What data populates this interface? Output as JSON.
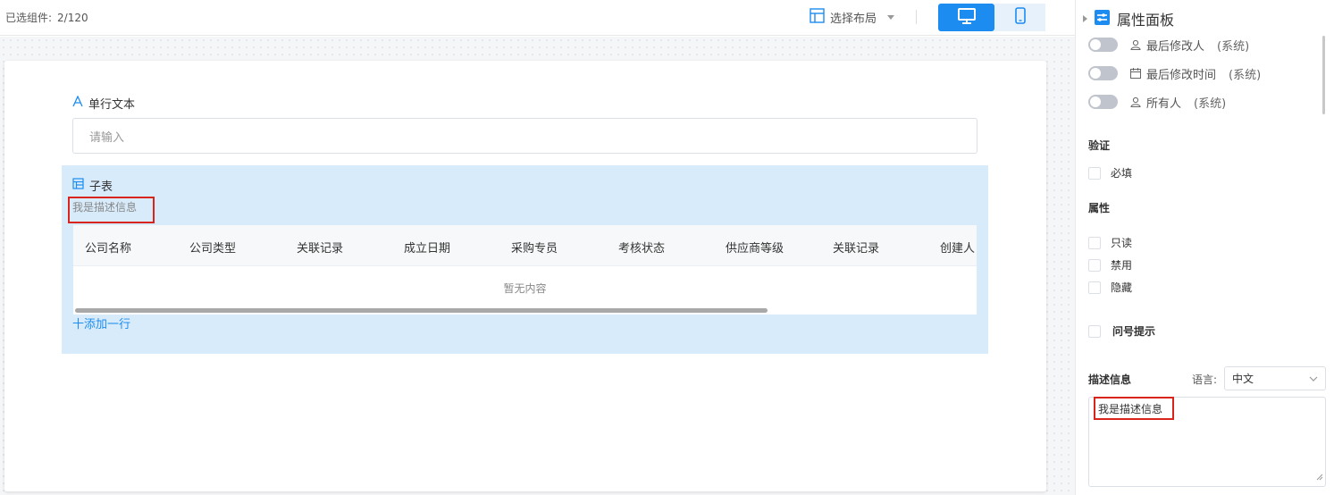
{
  "toolbar": {
    "selected_label": "已选组件:",
    "selected_count": "2/120",
    "layout_label": "选择布局",
    "accent": "#1c8cf0"
  },
  "form": {
    "text_field": {
      "label": "单行文本",
      "placeholder": "请输入"
    },
    "subtable": {
      "label": "子表",
      "description": "我是描述信息",
      "columns": [
        "公司名称",
        "公司类型",
        "关联记录",
        "成立日期",
        "采购专员",
        "考核状态",
        "供应商等级",
        "关联记录",
        "创建人"
      ],
      "empty_text": "暂无内容",
      "add_row": "十添加一行"
    }
  },
  "panel": {
    "title": "属性面板",
    "system_fields": [
      {
        "label": "最后修改人",
        "tag": "(系统)",
        "icon": "user-icon"
      },
      {
        "label": "最后修改时间",
        "tag": "(系统)",
        "icon": "calendar-icon"
      },
      {
        "label": "所有人",
        "tag": "(系统)",
        "icon": "user-icon"
      }
    ],
    "validation": {
      "heading": "验证",
      "required": "必填"
    },
    "properties": {
      "heading": "属性",
      "readonly": "只读",
      "disabled": "禁用",
      "hidden": "隐藏"
    },
    "tooltip_hint": "问号提示",
    "description": {
      "heading": "描述信息",
      "lang_label": "语言:",
      "lang_value": "中文",
      "value": "我是描述信息"
    }
  }
}
